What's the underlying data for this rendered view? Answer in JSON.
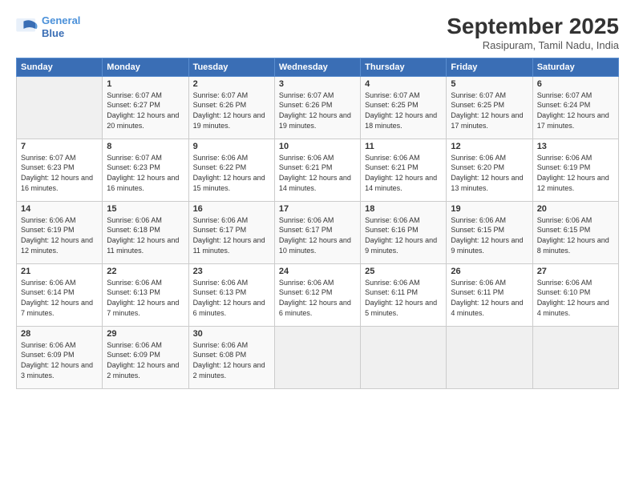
{
  "logo": {
    "line1": "General",
    "line2": "Blue"
  },
  "title": "September 2025",
  "location": "Rasipuram, Tamil Nadu, India",
  "days_header": [
    "Sunday",
    "Monday",
    "Tuesday",
    "Wednesday",
    "Thursday",
    "Friday",
    "Saturday"
  ],
  "weeks": [
    [
      {
        "day": "",
        "sunrise": "",
        "sunset": "",
        "daylight": ""
      },
      {
        "day": "1",
        "sunrise": "Sunrise: 6:07 AM",
        "sunset": "Sunset: 6:27 PM",
        "daylight": "Daylight: 12 hours and 20 minutes."
      },
      {
        "day": "2",
        "sunrise": "Sunrise: 6:07 AM",
        "sunset": "Sunset: 6:26 PM",
        "daylight": "Daylight: 12 hours and 19 minutes."
      },
      {
        "day": "3",
        "sunrise": "Sunrise: 6:07 AM",
        "sunset": "Sunset: 6:26 PM",
        "daylight": "Daylight: 12 hours and 19 minutes."
      },
      {
        "day": "4",
        "sunrise": "Sunrise: 6:07 AM",
        "sunset": "Sunset: 6:25 PM",
        "daylight": "Daylight: 12 hours and 18 minutes."
      },
      {
        "day": "5",
        "sunrise": "Sunrise: 6:07 AM",
        "sunset": "Sunset: 6:25 PM",
        "daylight": "Daylight: 12 hours and 17 minutes."
      },
      {
        "day": "6",
        "sunrise": "Sunrise: 6:07 AM",
        "sunset": "Sunset: 6:24 PM",
        "daylight": "Daylight: 12 hours and 17 minutes."
      }
    ],
    [
      {
        "day": "7",
        "sunrise": "Sunrise: 6:07 AM",
        "sunset": "Sunset: 6:23 PM",
        "daylight": "Daylight: 12 hours and 16 minutes."
      },
      {
        "day": "8",
        "sunrise": "Sunrise: 6:07 AM",
        "sunset": "Sunset: 6:23 PM",
        "daylight": "Daylight: 12 hours and 16 minutes."
      },
      {
        "day": "9",
        "sunrise": "Sunrise: 6:06 AM",
        "sunset": "Sunset: 6:22 PM",
        "daylight": "Daylight: 12 hours and 15 minutes."
      },
      {
        "day": "10",
        "sunrise": "Sunrise: 6:06 AM",
        "sunset": "Sunset: 6:21 PM",
        "daylight": "Daylight: 12 hours and 14 minutes."
      },
      {
        "day": "11",
        "sunrise": "Sunrise: 6:06 AM",
        "sunset": "Sunset: 6:21 PM",
        "daylight": "Daylight: 12 hours and 14 minutes."
      },
      {
        "day": "12",
        "sunrise": "Sunrise: 6:06 AM",
        "sunset": "Sunset: 6:20 PM",
        "daylight": "Daylight: 12 hours and 13 minutes."
      },
      {
        "day": "13",
        "sunrise": "Sunrise: 6:06 AM",
        "sunset": "Sunset: 6:19 PM",
        "daylight": "Daylight: 12 hours and 12 minutes."
      }
    ],
    [
      {
        "day": "14",
        "sunrise": "Sunrise: 6:06 AM",
        "sunset": "Sunset: 6:19 PM",
        "daylight": "Daylight: 12 hours and 12 minutes."
      },
      {
        "day": "15",
        "sunrise": "Sunrise: 6:06 AM",
        "sunset": "Sunset: 6:18 PM",
        "daylight": "Daylight: 12 hours and 11 minutes."
      },
      {
        "day": "16",
        "sunrise": "Sunrise: 6:06 AM",
        "sunset": "Sunset: 6:17 PM",
        "daylight": "Daylight: 12 hours and 11 minutes."
      },
      {
        "day": "17",
        "sunrise": "Sunrise: 6:06 AM",
        "sunset": "Sunset: 6:17 PM",
        "daylight": "Daylight: 12 hours and 10 minutes."
      },
      {
        "day": "18",
        "sunrise": "Sunrise: 6:06 AM",
        "sunset": "Sunset: 6:16 PM",
        "daylight": "Daylight: 12 hours and 9 minutes."
      },
      {
        "day": "19",
        "sunrise": "Sunrise: 6:06 AM",
        "sunset": "Sunset: 6:15 PM",
        "daylight": "Daylight: 12 hours and 9 minutes."
      },
      {
        "day": "20",
        "sunrise": "Sunrise: 6:06 AM",
        "sunset": "Sunset: 6:15 PM",
        "daylight": "Daylight: 12 hours and 8 minutes."
      }
    ],
    [
      {
        "day": "21",
        "sunrise": "Sunrise: 6:06 AM",
        "sunset": "Sunset: 6:14 PM",
        "daylight": "Daylight: 12 hours and 7 minutes."
      },
      {
        "day": "22",
        "sunrise": "Sunrise: 6:06 AM",
        "sunset": "Sunset: 6:13 PM",
        "daylight": "Daylight: 12 hours and 7 minutes."
      },
      {
        "day": "23",
        "sunrise": "Sunrise: 6:06 AM",
        "sunset": "Sunset: 6:13 PM",
        "daylight": "Daylight: 12 hours and 6 minutes."
      },
      {
        "day": "24",
        "sunrise": "Sunrise: 6:06 AM",
        "sunset": "Sunset: 6:12 PM",
        "daylight": "Daylight: 12 hours and 6 minutes."
      },
      {
        "day": "25",
        "sunrise": "Sunrise: 6:06 AM",
        "sunset": "Sunset: 6:11 PM",
        "daylight": "Daylight: 12 hours and 5 minutes."
      },
      {
        "day": "26",
        "sunrise": "Sunrise: 6:06 AM",
        "sunset": "Sunset: 6:11 PM",
        "daylight": "Daylight: 12 hours and 4 minutes."
      },
      {
        "day": "27",
        "sunrise": "Sunrise: 6:06 AM",
        "sunset": "Sunset: 6:10 PM",
        "daylight": "Daylight: 12 hours and 4 minutes."
      }
    ],
    [
      {
        "day": "28",
        "sunrise": "Sunrise: 6:06 AM",
        "sunset": "Sunset: 6:09 PM",
        "daylight": "Daylight: 12 hours and 3 minutes."
      },
      {
        "day": "29",
        "sunrise": "Sunrise: 6:06 AM",
        "sunset": "Sunset: 6:09 PM",
        "daylight": "Daylight: 12 hours and 2 minutes."
      },
      {
        "day": "30",
        "sunrise": "Sunrise: 6:06 AM",
        "sunset": "Sunset: 6:08 PM",
        "daylight": "Daylight: 12 hours and 2 minutes."
      },
      {
        "day": "",
        "sunrise": "",
        "sunset": "",
        "daylight": ""
      },
      {
        "day": "",
        "sunrise": "",
        "sunset": "",
        "daylight": ""
      },
      {
        "day": "",
        "sunrise": "",
        "sunset": "",
        "daylight": ""
      },
      {
        "day": "",
        "sunrise": "",
        "sunset": "",
        "daylight": ""
      }
    ]
  ]
}
